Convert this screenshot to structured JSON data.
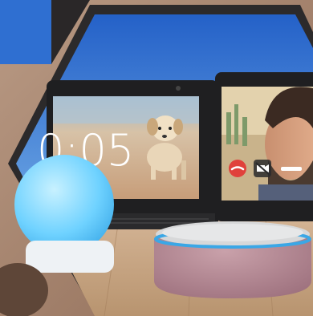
{
  "screen": {
    "clock_time": "0:05"
  },
  "call": {
    "end_call_icon": "phone-hangup-icon",
    "video_off_icon": "video-off-icon"
  },
  "colors": {
    "hexagon_frame": "#2c2a2b",
    "sky_blue": "#2f6fd1",
    "echo_dot_fabric": "#b98c97",
    "light_ring": "#3aa7e6",
    "end_call_red": "#e0413b"
  }
}
